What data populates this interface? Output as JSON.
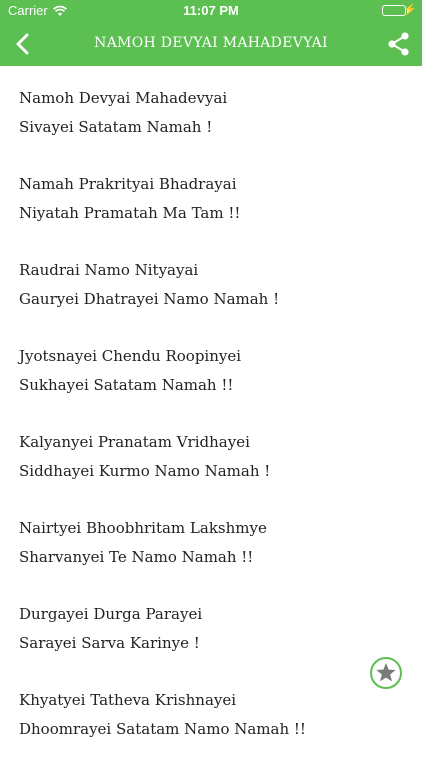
{
  "status_bar": {
    "carrier": "Carrier",
    "time": "11:07 PM"
  },
  "nav": {
    "title": "NAMOH DEVYAI MAHADEVYAI"
  },
  "colors": {
    "accent": "#5cbf52"
  },
  "icons": {
    "back": "chevron-left-icon",
    "share": "share-icon",
    "favorite": "star-icon"
  },
  "stanzas": [
    {
      "lines": [
        "Namoh Devyai Mahadevyai",
        "Sivayei Satatam Namah !"
      ]
    },
    {
      "lines": [
        "Namah Prakrityai Bhadrayai",
        "Niyatah Pramatah Ma Tam !!"
      ]
    },
    {
      "lines": [
        "Raudrai Namo Nityayai",
        "Gauryei Dhatrayei Namo Namah !"
      ]
    },
    {
      "lines": [
        "Jyotsnayei Chendu Roopinyei",
        "Sukhayei Satatam Namah !!"
      ]
    },
    {
      "lines": [
        "Kalyanyei Pranatam Vridhayei",
        "Siddhayei Kurmo Namo Namah !"
      ]
    },
    {
      "lines": [
        "Nairtyei Bhoobhritam Lakshmye",
        "Sharvanyei Te Namo Namah !!"
      ]
    },
    {
      "lines": [
        "Durgayei Durga Parayei",
        "Sarayei Sarva Karinye !"
      ]
    },
    {
      "lines": [
        "Khyatyei Tatheva Krishnayei",
        "Dhoomrayei Satatam Namo Namah !!"
      ]
    }
  ]
}
